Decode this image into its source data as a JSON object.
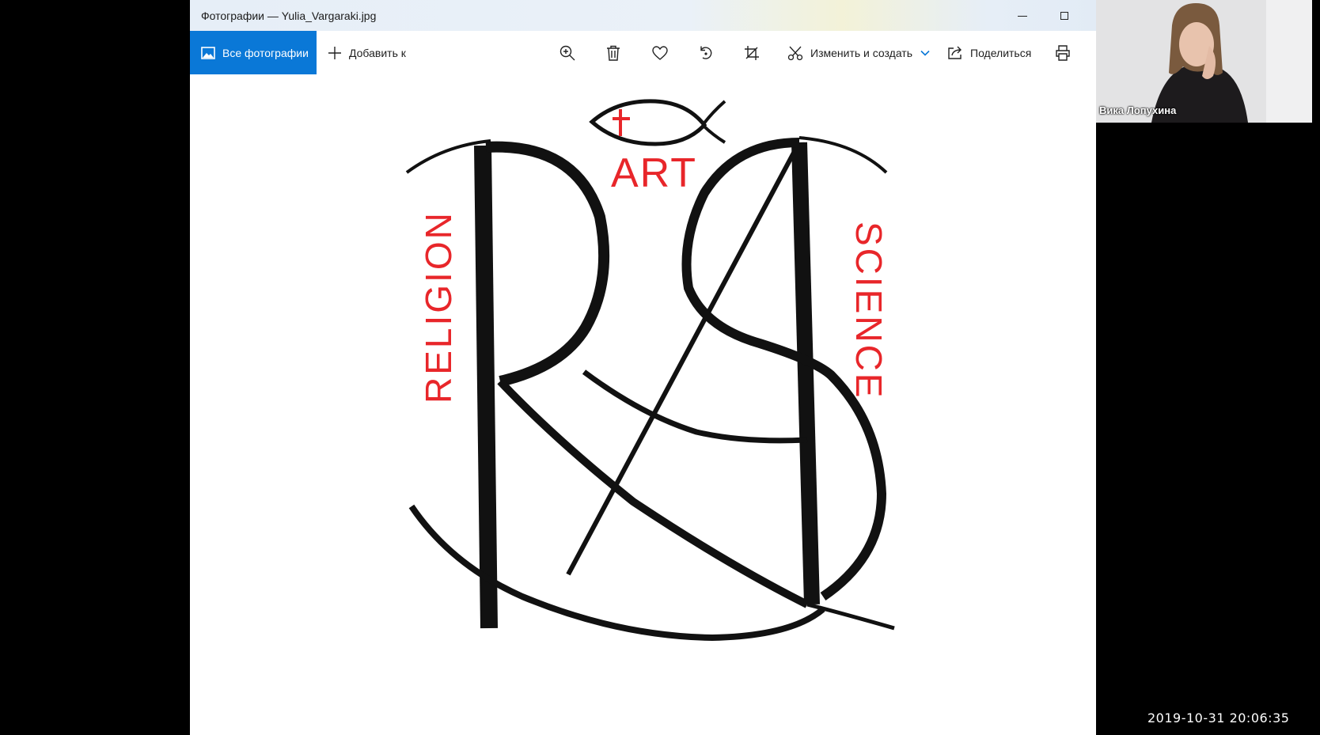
{
  "window": {
    "title": "Фотографии — Yulia_Vargaraki.jpg"
  },
  "toolbar": {
    "all_photos_label": "Все фотографии",
    "add_to_label": "Добавить к",
    "edit_create_label": "Изменить и создать",
    "share_label": "Поделиться"
  },
  "artwork": {
    "top_word": "ART",
    "left_word": "RELIGION",
    "right_word": "SCIENCE",
    "ink_color": "#111111",
    "accent_color": "#e8262a"
  },
  "video": {
    "participant_name": "Вика Лопухина"
  },
  "overlay": {
    "timestamp": "2019-10-31  20:06:35"
  },
  "colors": {
    "accent": "#0a78d7"
  }
}
